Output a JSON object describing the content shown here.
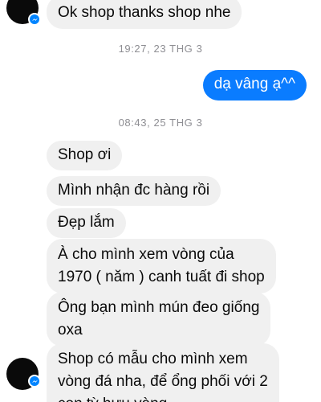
{
  "messages": [
    {
      "id": "m0",
      "text": "Ok shop thanks shop nhe",
      "direction": "incoming"
    },
    {
      "id": "t1",
      "timestamp": "19:27, 23 THG 3"
    },
    {
      "id": "m1",
      "text": "dạ vâng ạ^^",
      "direction": "outgoing"
    },
    {
      "id": "t2",
      "timestamp": "08:43, 25 THG 3"
    },
    {
      "id": "m2",
      "text": "Shop ơi",
      "direction": "incoming"
    },
    {
      "id": "m3",
      "text": "Mình nhận đc hàng rồi",
      "direction": "incoming"
    },
    {
      "id": "m4",
      "text": "Đẹp lắm",
      "direction": "incoming"
    },
    {
      "id": "m5",
      "lines": [
        "À cho mình xem vòng của",
        "1970 ( năm ) canh tuất đi shop"
      ],
      "direction": "incoming"
    },
    {
      "id": "m6",
      "lines": [
        "Ông bạn mình mún đeo giống",
        "oxa"
      ],
      "direction": "incoming"
    },
    {
      "id": "m7",
      "lines": [
        "Shop có mẫu cho mình xem",
        "vòng đá nha, để ổng phối với 2",
        "con tỳ hưu vàng"
      ],
      "direction": "incoming"
    }
  ],
  "colors": {
    "incoming_bubble": "#f0f0f0",
    "outgoing_bubble": "#0a7cff",
    "timestamp": "#8e8e93",
    "messenger_badge": "#0084ff"
  },
  "icons": {
    "sender_badge": "messenger-icon"
  }
}
